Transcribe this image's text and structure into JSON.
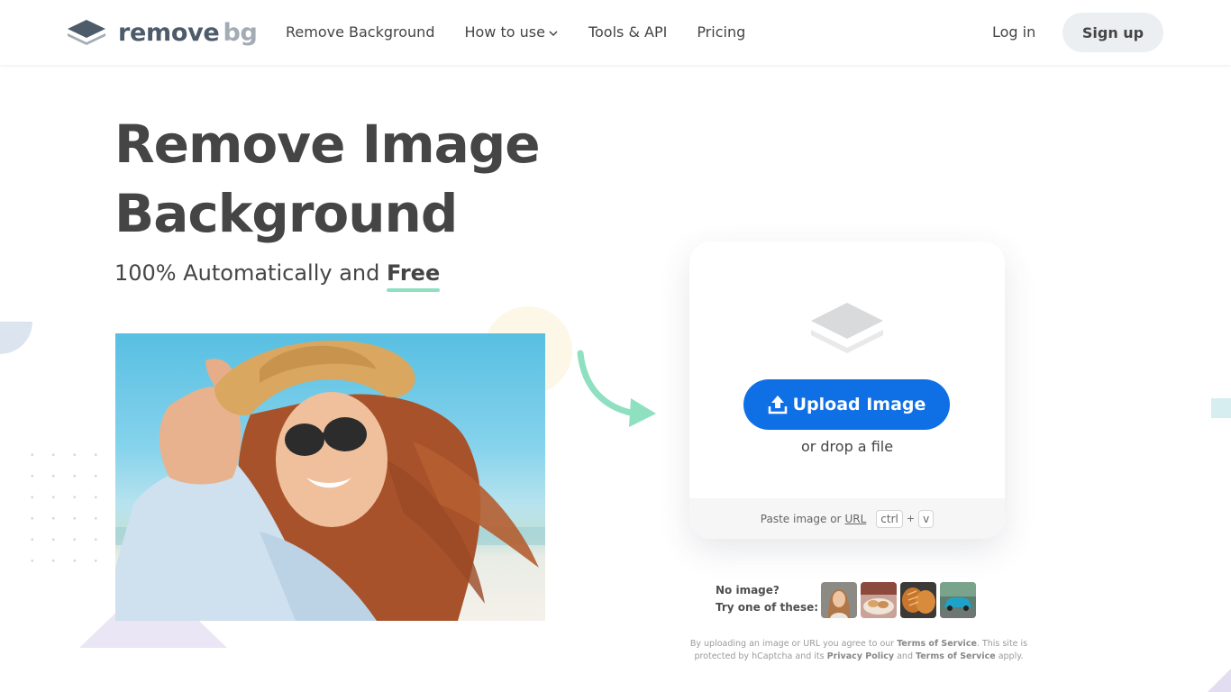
{
  "header": {
    "logo": {
      "remove": "remove",
      "bg": "bg"
    },
    "nav": [
      {
        "label": "Remove Background"
      },
      {
        "label": "How to use"
      },
      {
        "label": "Tools & API"
      },
      {
        "label": "Pricing"
      }
    ],
    "login_label": "Log in",
    "signup_label": "Sign up"
  },
  "hero": {
    "title": "Remove Image Background",
    "subtitle_prefix": "100% Automatically and ",
    "subtitle_highlight": "Free"
  },
  "upload": {
    "button_label": "Upload Image",
    "drop_text": "or drop a file",
    "paste_text": "Paste image or",
    "url_label": "URL",
    "kbd_ctrl": "ctrl",
    "kbd_plus": "+",
    "kbd_v": "v"
  },
  "samples": {
    "line1": "No image?",
    "line2": "Try one of these:",
    "items": [
      "woman-sample",
      "bread-basket-sample",
      "bread-loaves-sample",
      "car-sample"
    ]
  },
  "legal": {
    "part1": "By uploading an image or URL you agree to our ",
    "tos1": "Terms of Service",
    "part2": ". This site is protected by hCaptcha and its ",
    "privacy": "Privacy Policy",
    "part3": " and ",
    "tos2": "Terms of Service",
    "part4": " apply."
  },
  "colors": {
    "primary": "#0f70e6",
    "accent_underline": "#8fe0c1",
    "arrow": "#8fe0c1",
    "text": "#454545"
  }
}
